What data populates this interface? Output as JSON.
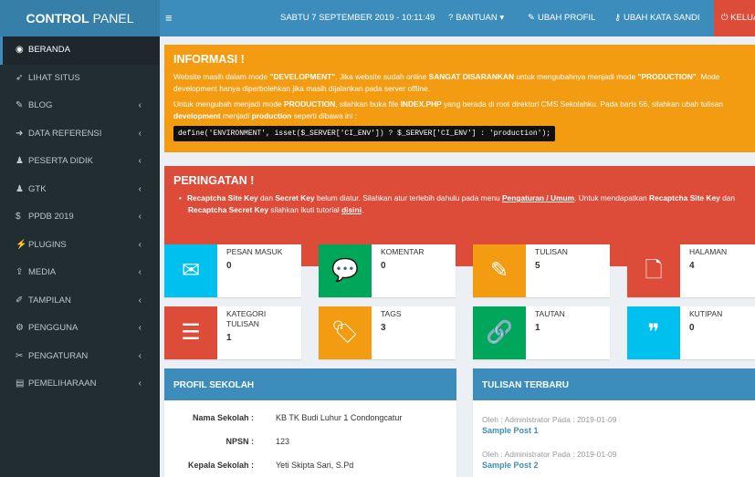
{
  "header": {
    "brand_bold": "CONTROL",
    "brand_light": " PANEL",
    "toggle": "≡",
    "datetime": "SABTU 7 SEPTEMBER 2019 - 10:11:49",
    "bantuan": "BANTUAN",
    "ubah_profil": "UBAH PROFIL",
    "ubah_sandi": "UBAH KATA SANDI",
    "keluar": "KELUAR",
    "colors": {
      "topbar": "#3c8dbc",
      "brand": "#367fa9",
      "logout": "#dd4b39"
    }
  },
  "sidebar": {
    "items": [
      {
        "label": "BERANDA",
        "icon": "dashboard-icon",
        "active": true
      },
      {
        "label": "LIHAT SITUS",
        "icon": "rocket-icon"
      },
      {
        "label": "BLOG",
        "icon": "edit-icon"
      },
      {
        "label": "DATA REFERENSI",
        "icon": "sign-in-icon"
      },
      {
        "label": "PESERTA DIDIK",
        "icon": "users-icon"
      },
      {
        "label": "GTK",
        "icon": "users-icon"
      },
      {
        "label": "PPDB 2019",
        "icon": "dollar-icon"
      },
      {
        "label": "PLUGINS",
        "icon": "plug-icon"
      },
      {
        "label": "MEDIA",
        "icon": "upload-icon"
      },
      {
        "label": "TAMPILAN",
        "icon": "paint-brush-icon"
      },
      {
        "label": "PENGGUNA",
        "icon": "cogs-icon"
      },
      {
        "label": "PENGATURAN",
        "icon": "wrench-icon"
      },
      {
        "label": "PEMELIHARAAN",
        "icon": "database-icon"
      }
    ]
  },
  "informasi": {
    "title": "INFORMASI !",
    "p1_a": "Website masih dalam mode ",
    "p1_b": "\"DEVELOPMENT\"",
    "p1_c": ". Jika website sudah online ",
    "p1_d": "SANGAT DISARANKAN",
    "p1_e": " untuk mengubahnya menjadi mode ",
    "p1_f": "\"PRODUCTION\"",
    "p1_g": ". Mode development hanya diperbolehkan jika masih dijalankan pada server offline.",
    "p2_a": "Untuk mengubah menjadi mode ",
    "p2_b": "PRODUCTION",
    "p2_c": ", silahkan buka file ",
    "p2_d": "INDEX.PHP",
    "p2_e": " yang berada di root direktori CMS Sekolahku. Pada baris 56, silahkan ubah tulisan ",
    "p2_f": "development",
    "p2_g": " menjadi ",
    "p2_h": "production",
    "p2_i": " seperti dibawa ini :",
    "code": "define('ENVIRONMENT', isset($_SERVER['CI_ENV']) ? $_SERVER['CI_ENV'] : 'production');"
  },
  "peringatan": {
    "title": "PERINGATAN !",
    "t1": "Recaptcha Site Key",
    "t2": " dan ",
    "t3": "Secret Key",
    "t4": " belum diatur. Silahkan atur terlebih dahulu pada menu ",
    "t5": "Pengaturan / Umum",
    "t6": ". Untuk mendapatkan ",
    "t7": "Recaptcha Site Key",
    "t8": " dan ",
    "t9": "Recaptcha Secret Key",
    "t10": " silahkan ikuti tutorial ",
    "t11": "disini",
    "t12": "."
  },
  "stats": [
    {
      "label": "PESAN MASUK",
      "value": "0",
      "color": "#00c0ef",
      "icon": "envelope-icon"
    },
    {
      "label": "KOMENTAR",
      "value": "0",
      "color": "#00a65a",
      "icon": "comments-icon"
    },
    {
      "label": "TULISAN",
      "value": "5",
      "color": "#f39c12",
      "icon": "edit-icon"
    },
    {
      "label": "HALAMAN",
      "value": "4",
      "color": "#dd4b39",
      "icon": "file-icon"
    },
    {
      "label": "KATEGORI",
      "label2": "TULISAN",
      "value": "1",
      "color": "#dd4b39",
      "icon": "list-icon"
    },
    {
      "label": "TAGS",
      "value": "3",
      "color": "#f39c12",
      "icon": "tag-icon"
    },
    {
      "label": "TAUTAN",
      "value": "1",
      "color": "#00a65a",
      "icon": "link-icon"
    },
    {
      "label": "KUTIPAN",
      "value": "0",
      "color": "#00c0ef",
      "icon": "quote-icon"
    }
  ],
  "profil": {
    "title": "PROFIL SEKOLAH",
    "rows": [
      {
        "label": "Nama Sekolah :",
        "value": "KB TK Budi Luhur 1 Condongcatur"
      },
      {
        "label": "NPSN :",
        "value": "123"
      },
      {
        "label": "Kepala Sekolah :",
        "value": "Yeti Skipta Sari, S.Pd"
      }
    ]
  },
  "tulisan": {
    "title": "TULISAN TERBARU",
    "posts": [
      {
        "meta": "Oleh : Administrator Pada : 2019-01-09",
        "title": "Sample Post 1"
      },
      {
        "meta": "Oleh : Administrator Pada : 2019-01-09",
        "title": "Sample Post 2"
      }
    ]
  }
}
